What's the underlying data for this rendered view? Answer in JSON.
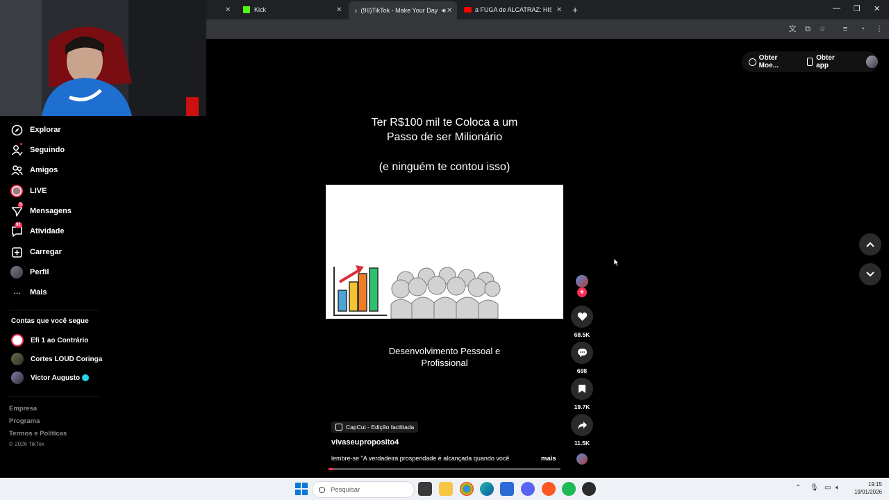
{
  "browser": {
    "tabs": [
      {
        "label": "Kick",
        "icon": "kick-icon"
      },
      {
        "label": "(96)TikTok - Make Your Day",
        "icon": "tiktok-icon"
      },
      {
        "label": "a FUGA de ALCATRAZ: HISTÓRI",
        "icon": "youtube-icon"
      }
    ]
  },
  "sidebar": {
    "items": [
      {
        "label": "Explorar",
        "icon": "compass-icon"
      },
      {
        "label": "Seguindo",
        "icon": "following-icon"
      },
      {
        "label": "Amigos",
        "icon": "friends-icon"
      },
      {
        "label": "LIVE",
        "icon": "live-icon"
      },
      {
        "label": "Mensagens",
        "icon": "messages-icon",
        "badge": "5"
      },
      {
        "label": "Atividade",
        "icon": "activity-icon",
        "badge": "91"
      },
      {
        "label": "Carregar",
        "icon": "upload-icon"
      },
      {
        "label": "Perfil",
        "icon": "profile-avatar"
      },
      {
        "label": "Mais",
        "icon": "more-icon"
      }
    ],
    "following_title": "Contas que você segue",
    "following": [
      {
        "name": "Efi 1 ao Contrário"
      },
      {
        "name": "Cortes LOUD Coringa"
      },
      {
        "name": "Victor Augusto",
        "verified": true
      }
    ],
    "footer": {
      "links": [
        "Empresa",
        "Programa",
        "Termos e Políticas"
      ],
      "copyright": "© 2026 TikTok"
    }
  },
  "header": {
    "coins_label": "Obter Moe...",
    "app_label": "Obter app"
  },
  "video": {
    "title_line1": "Ter R$100 mil te Coloca a um",
    "title_line2": "Passo de ser Milionário",
    "title_line3": "(e ninguém te contou isso)",
    "subtitle_line1": "Desenvolvimento Pessoal e",
    "subtitle_line2": "Profissional",
    "capcut_label": "CapCut - Edição facilitada",
    "author": "vivaseuproposito4",
    "description": "lembre-se \"A verdadeira prosperidade é alcançada quando você",
    "more_label": "mais",
    "progress": 0.02
  },
  "actions": {
    "likes": "68.5K",
    "comments": "698",
    "saves": "19.7K",
    "shares": "11.5K"
  },
  "taskbar": {
    "search_placeholder": "Pesquisar",
    "time": "19:15",
    "date": "19/01/2026"
  },
  "colors": {
    "accent": "#fe2c55",
    "background": "#000000",
    "taskbar": "#eef1f6"
  }
}
